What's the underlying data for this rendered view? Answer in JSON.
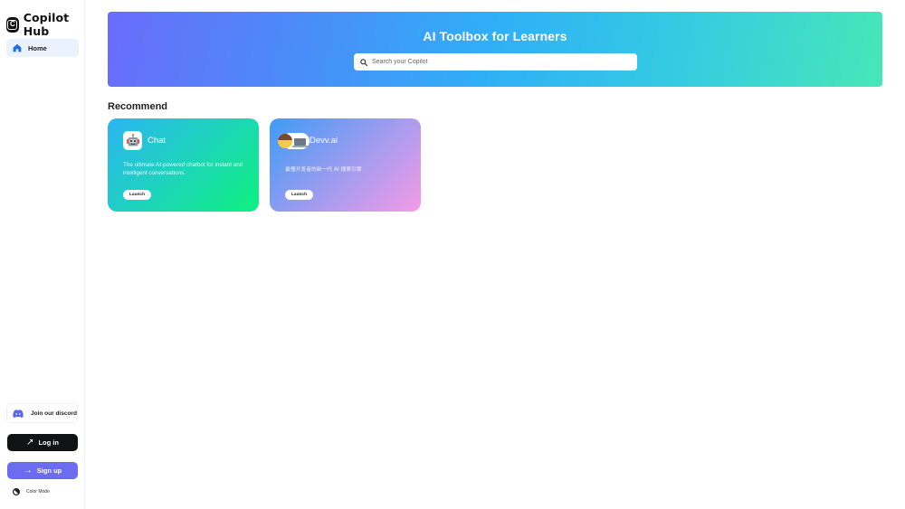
{
  "sidebar": {
    "brand": {
      "name": "Copilot Hub",
      "logo_letter": "C"
    },
    "nav": [
      {
        "label": "Home",
        "icon": "home-icon",
        "active": true
      }
    ],
    "discord_label": "Join our discord",
    "login_label": "Log in",
    "signup_label": "Sign up",
    "color_mode_label": "Color Mode"
  },
  "hero": {
    "title": "AI Toolbox for Learners",
    "search": {
      "placeholder": "Search your Copilot",
      "value": ""
    }
  },
  "recommend": {
    "title": "Recommend",
    "cards": [
      {
        "name": "Chat",
        "icon": "robot-icon",
        "description": "The ultimate AI-powered chatbot for instant and intelligent conversations.",
        "action_label": "Launch"
      },
      {
        "name": "Devv.ai",
        "icon": "developer-avatar-icon",
        "description": "最懂开发者的新一代 AI 搜索引擎",
        "action_label": "Launch"
      }
    ]
  },
  "colors": {
    "accent_signup": "#6b6cf0",
    "login_bg": "#111214",
    "nav_active_bg": "#eaf3fd",
    "home_icon": "#1f6fe5",
    "discord_icon": "#5865f2"
  }
}
